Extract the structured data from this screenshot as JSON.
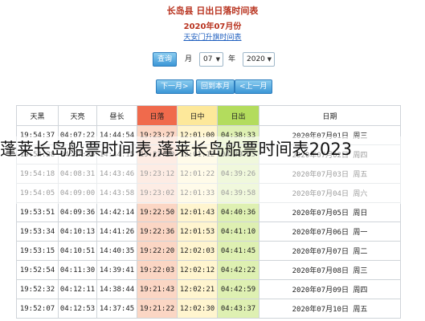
{
  "header": {
    "title": "长岛县 日出日落时间表",
    "subtitle": "2020年07月份",
    "link": "天安门升旗时间表"
  },
  "controls": {
    "query_button": "查询",
    "month_value": "07",
    "month_label": "月",
    "year_value": "2020",
    "year_label": "年"
  },
  "nav": {
    "next_month": "下一月>",
    "back_this_month": "回到本月",
    "prev_month": "<上一月"
  },
  "table": {
    "headers": [
      "天黑",
      "天亮",
      "昼长",
      "日落",
      "日中",
      "日出",
      "日期"
    ],
    "rows": [
      [
        "19:54:37",
        "04:07:22",
        "14:44:54",
        "19:23:27",
        "12:01:00",
        "04:38:33",
        "2020年07月01日 周三"
      ],
      [
        "19:54:28",
        "04:07:56",
        "14:44:15",
        "19:23:20",
        "12:01:12",
        "04:39:05",
        "2020年07月02日 周四"
      ],
      [
        "19:54:18",
        "04:08:31",
        "14:43:46",
        "19:23:12",
        "12:01:22",
        "04:39:26",
        "2020年07月03日 周五"
      ],
      [
        "19:54:05",
        "04:09:00",
        "14:43:58",
        "19:23:02",
        "12:01:33",
        "04:39:58",
        "2020年07月04日 周六"
      ],
      [
        "19:53:51",
        "04:09:36",
        "14:42:14",
        "19:22:50",
        "12:01:43",
        "04:40:36",
        "2020年07月05日 周日"
      ],
      [
        "19:53:34",
        "04:10:13",
        "14:41:26",
        "19:22:36",
        "12:01:53",
        "04:41:10",
        "2020年07月06日 周一"
      ],
      [
        "19:53:15",
        "04:10:51",
        "14:40:35",
        "19:22:20",
        "12:02:03",
        "04:41:45",
        "2020年07月07日 周二"
      ],
      [
        "19:52:54",
        "04:11:30",
        "14:39:41",
        "19:22:03",
        "12:02:12",
        "04:42:22",
        "2020年07月08日 周三"
      ],
      [
        "19:52:32",
        "04:12:11",
        "14:38:44",
        "19:21:43",
        "12:02:21",
        "04:42:59",
        "2020年07月09日 周四"
      ],
      [
        "19:52:07",
        "04:12:53",
        "14:37:45",
        "19:21:22",
        "12:02:30",
        "04:43:37",
        "2020年07月10日 周五"
      ]
    ]
  },
  "overlay_text": "蓬莱长岛船票时间表,蓬莱长岛船票时间表2023",
  "colors": {
    "sunset_header": "#f06a4c",
    "noon_header": "#fde89a",
    "sunrise_header": "#b3dc5d",
    "button_blue": "#3c96d6",
    "title_red": "#b8321e"
  }
}
